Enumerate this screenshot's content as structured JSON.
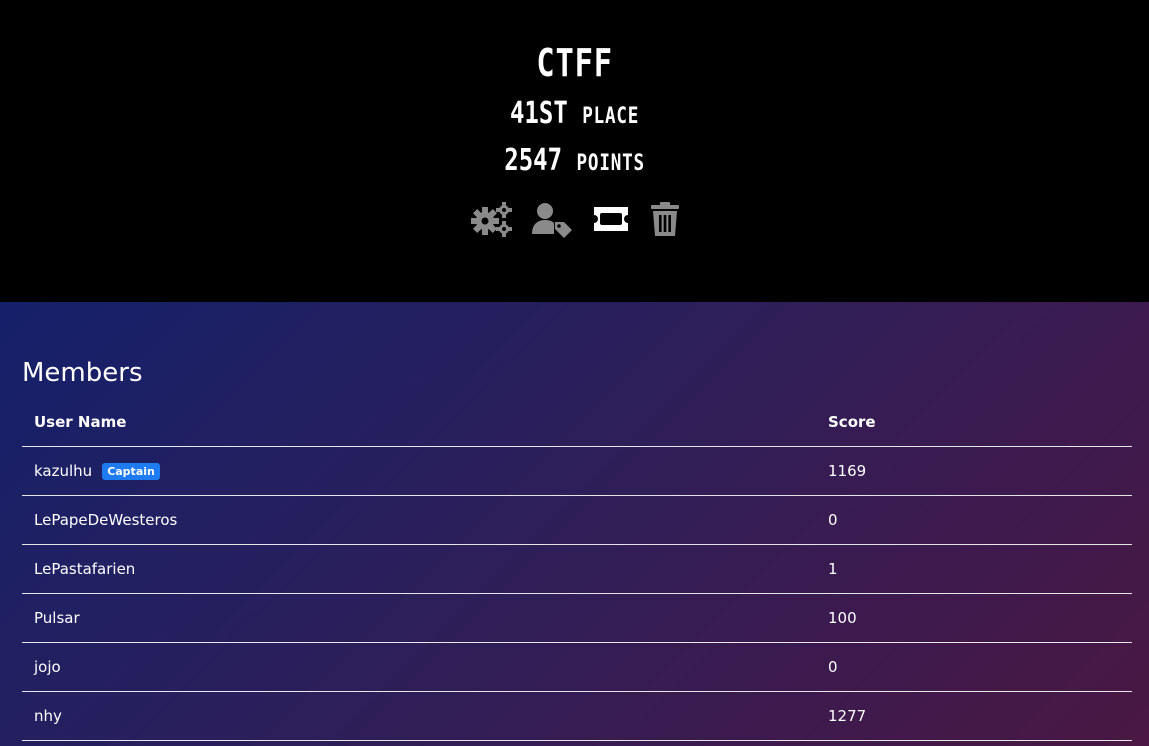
{
  "team": {
    "name": "CTFF",
    "place_number": "41st",
    "place_label": "place",
    "points_number": "2547",
    "points_label": "points"
  },
  "actions": [
    {
      "icon": "gears-icon"
    },
    {
      "icon": "user-tag-icon"
    },
    {
      "icon": "ticket-icon"
    },
    {
      "icon": "trash-icon"
    }
  ],
  "members": {
    "title": "Members",
    "columns": {
      "user_name": "User Name",
      "score": "Score"
    },
    "rows": [
      {
        "name": "kazulhu",
        "badge": "Captain",
        "score": "1169"
      },
      {
        "name": "LePapeDeWesteros",
        "score": "0"
      },
      {
        "name": "LePastafarien",
        "score": "1"
      },
      {
        "name": "Pulsar",
        "score": "100"
      },
      {
        "name": "jojo",
        "score": "0"
      },
      {
        "name": "nhy",
        "score": "1277"
      }
    ]
  },
  "colors": {
    "header_bg": "#000000",
    "icon_gray": "#8a8a8a",
    "badge_blue": "#1e7bf2",
    "gradient_start": "#15206a",
    "gradient_end": "#4a1842"
  }
}
